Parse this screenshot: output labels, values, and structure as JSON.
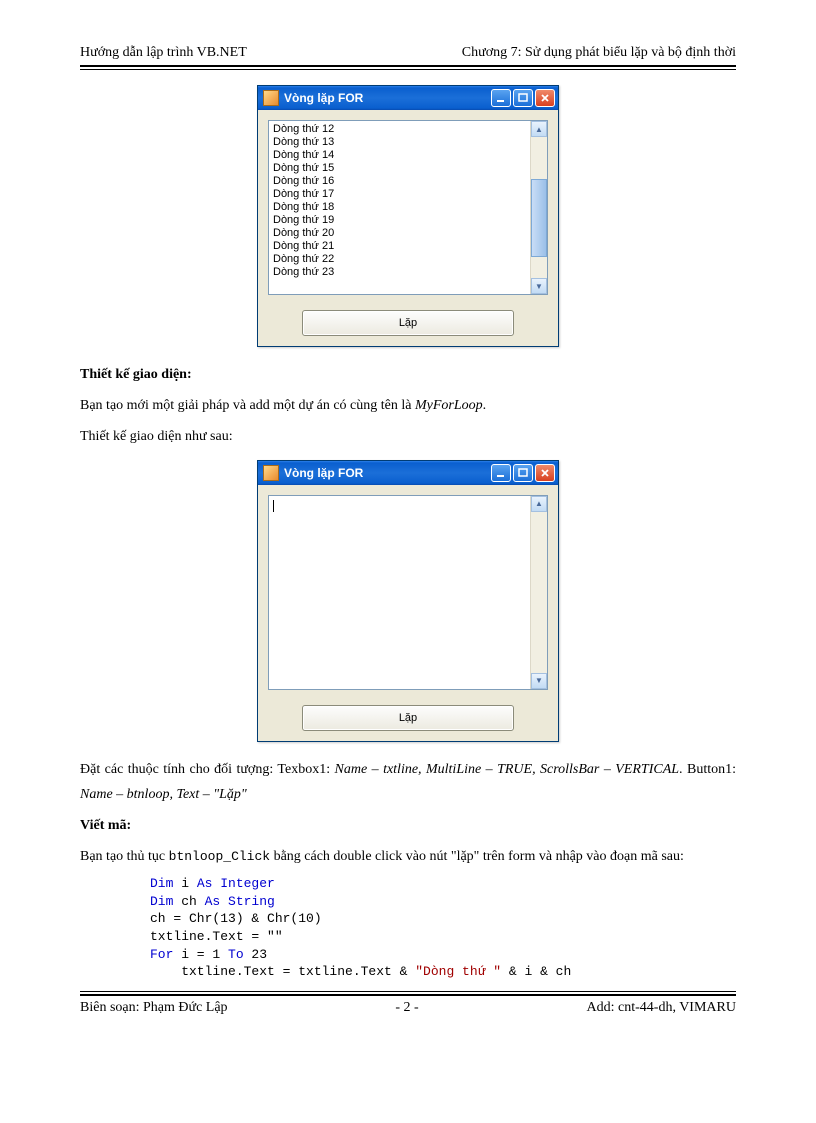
{
  "header": {
    "left": "Hướng dẫn lập trình  VB.NET",
    "right": "Chương 7: Sử dụng phát biểu lặp và bộ định thời"
  },
  "footer": {
    "left": "Biên soạn: Phạm Đức Lập",
    "center": "- 2 -",
    "right": "Add: cnt-44-dh, VIMARU"
  },
  "win1": {
    "title": "Vòng lặp FOR",
    "lines": "Dòng thứ 12\nDòng thứ 13\nDòng thứ 14\nDòng thứ 15\nDòng thứ 16\nDòng thứ 17\nDòng thứ 18\nDòng thứ 19\nDòng thứ 20\nDòng thứ 21\nDòng thứ 22\nDòng thứ 23",
    "button": "Lặp"
  },
  "win2": {
    "title": "Vòng lặp FOR",
    "button": "Lặp"
  },
  "text": {
    "h1": "Thiết kế giao diện:",
    "p1a": "Bạn tạo mới một giải pháp và add một dự án có cùng tên là ",
    "p1b": "MyForLoop",
    "p1c": ".",
    "p2": "Thiết kế giao diện như sau:",
    "p3a": "Đặt các thuộc tính cho đối tượng: Texbox1: ",
    "p3b": "Name – txtline, MultiLine – TRUE, ScrollsBar – VERTICAL",
    "p3c": ". Button1: ",
    "p3d": "Name – btnloop, Text – \"Lặp\"",
    "h2": "Viết mã:",
    "p4a": "Bạn tạo thủ tục ",
    "p4b": "btnloop_Click",
    "p4c": " bằng cách double click vào nút \"lặp\" trên form và nhập vào đoạn mã sau:"
  },
  "code": {
    "l1_dim": "Dim",
    "l1_var": " i ",
    "l1_as": "As Integer",
    "l2_dim": "Dim",
    "l2_var": " ch ",
    "l2_as": "As String",
    "l3": "ch = Chr(13) & Chr(10)",
    "l4": "txtline.Text = \"\"",
    "l5_for": "For",
    "l5_mid": " i = 1 ",
    "l5_to": "To",
    "l5_end": " 23",
    "l6_a": "    txtline.Text = txtline.Text & ",
    "l6_str": "\"Dòng thứ \"",
    "l6_b": " & i & ch"
  }
}
